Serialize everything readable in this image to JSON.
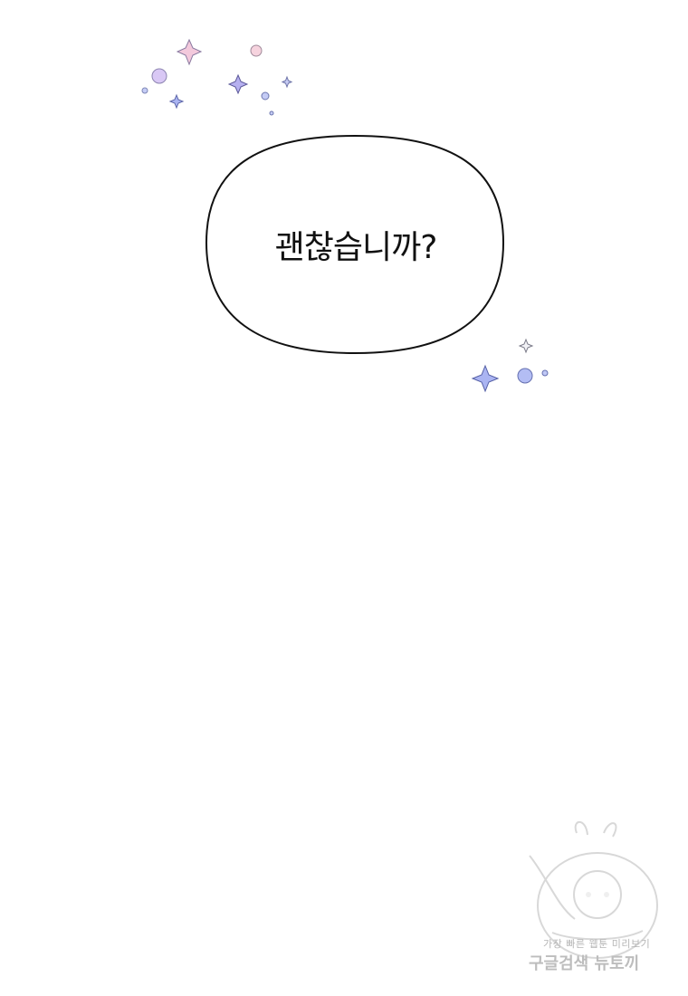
{
  "panel": {
    "speech_text": "괜찮습니까?"
  },
  "watermark": {
    "line1": "가장 빠른 웹툰 미리보기",
    "line2": "구글검색 뉴토끼"
  },
  "colors": {
    "background": "#ffffff",
    "bubble_stroke": "#111111",
    "sparkle_pink": "#f3c9dc",
    "sparkle_blue": "#aab4f2",
    "sparkle_purple": "#c9b7f0",
    "watermark_gray": "#bdbdbd"
  }
}
